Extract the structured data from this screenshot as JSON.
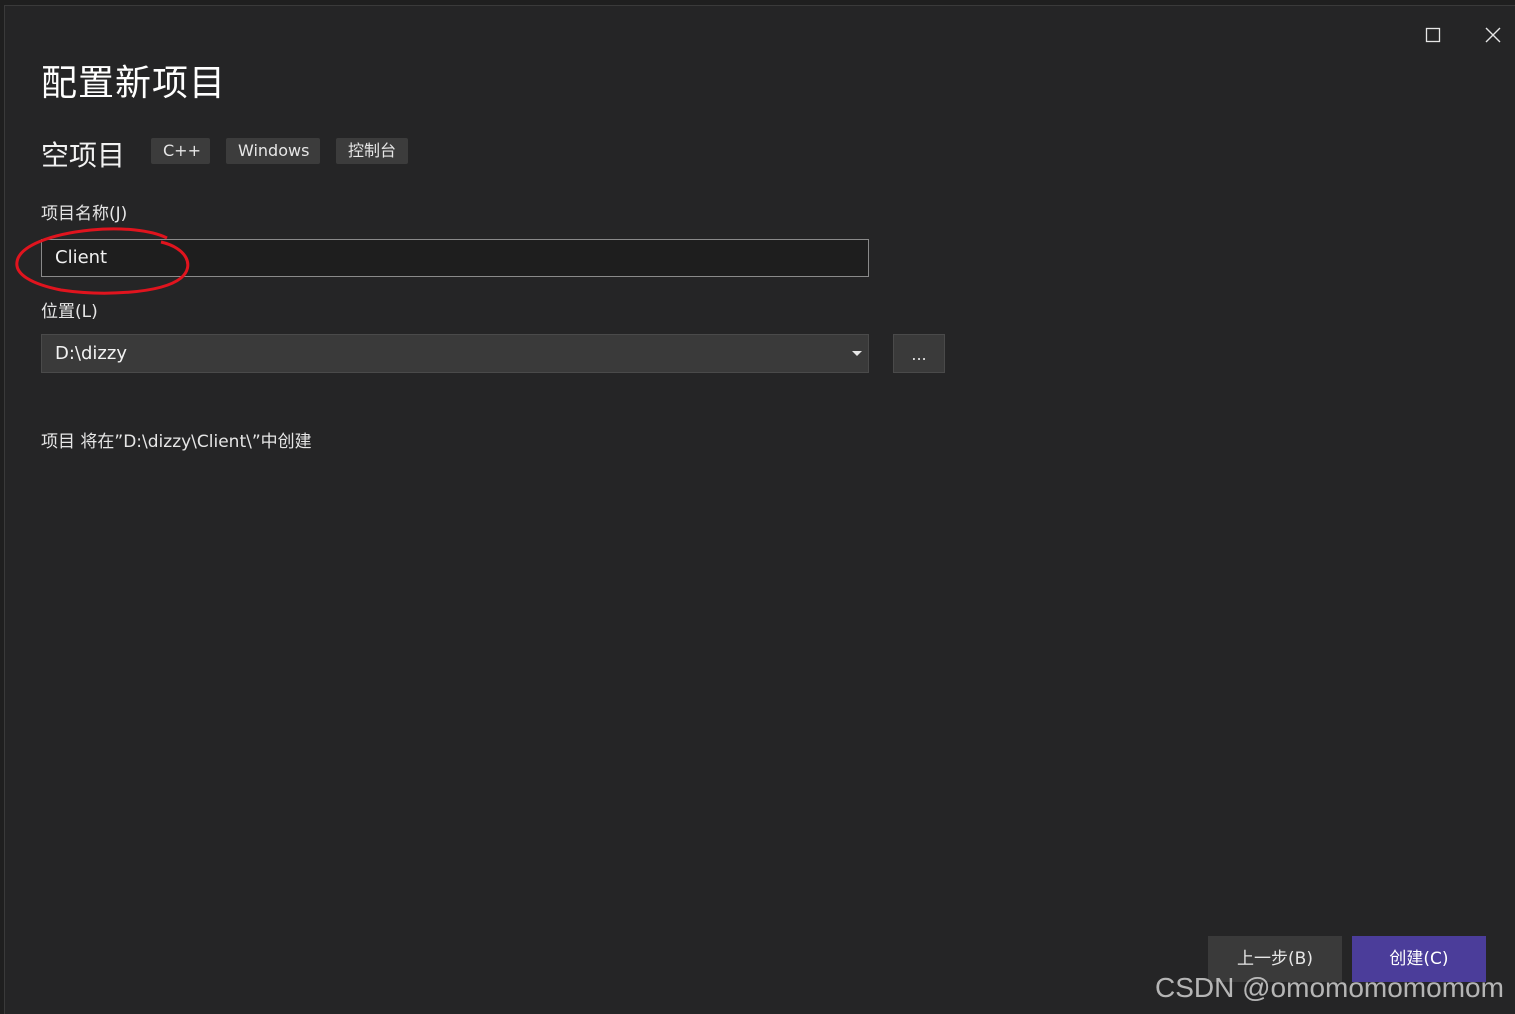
{
  "window": {
    "maximize_icon": "maximize-icon",
    "close_icon": "close-icon"
  },
  "header": {
    "title": "配置新项目",
    "template_name": "空项目",
    "tags": [
      "C++",
      "Windows",
      "控制台"
    ]
  },
  "form": {
    "project_name_label": "项目名称(J)",
    "project_name_value": "Client",
    "location_label": "位置(L)",
    "location_value": "D:\\dizzy",
    "browse_label": "...",
    "create_info": "项目 将在”D:\\dizzy\\Client\\”中创建"
  },
  "footer": {
    "back_label": "上一步(B)",
    "create_label": "创建(C)"
  },
  "colors": {
    "background": "#252526",
    "create_button": "#4b3d9a",
    "annotation": "#e0141e"
  },
  "watermark": "CSDN @omomomomomom"
}
